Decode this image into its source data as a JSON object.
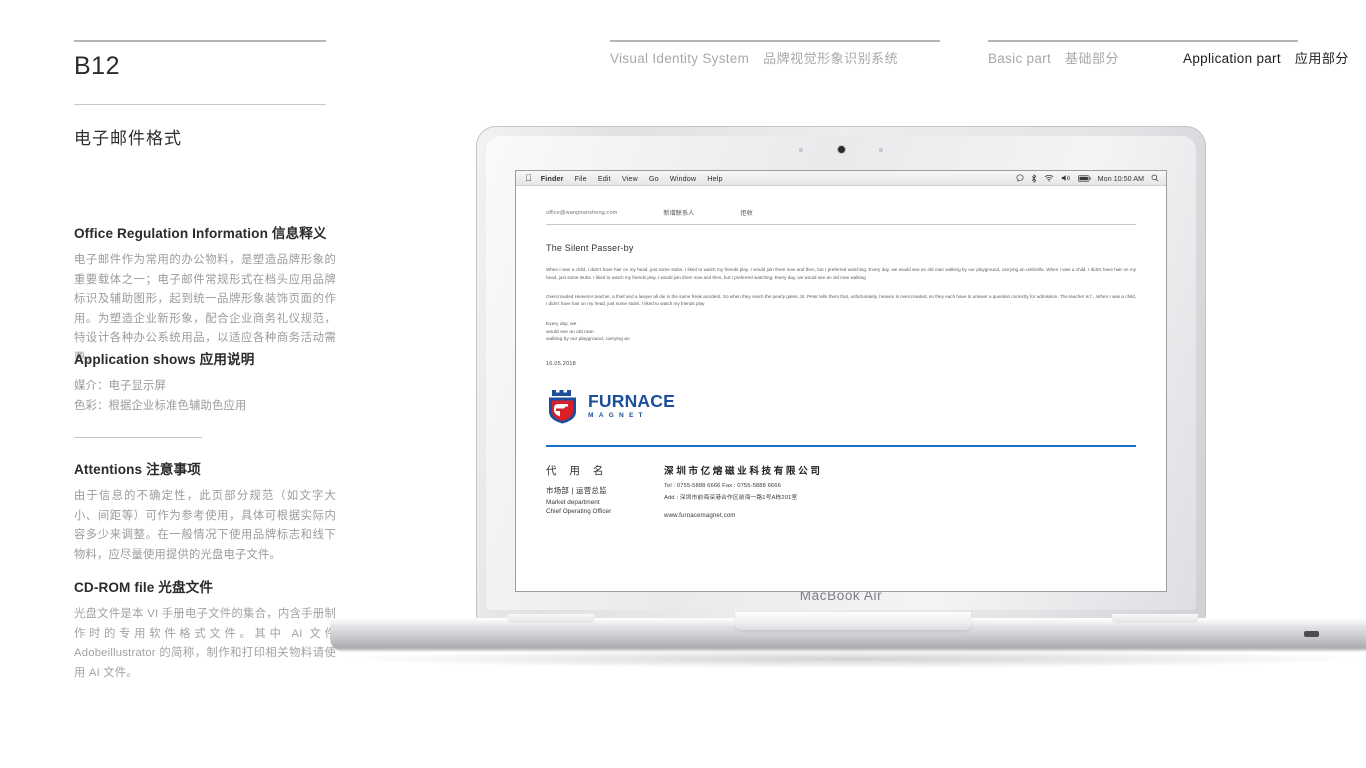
{
  "header": {
    "page_code": "B12",
    "sheet_title": "电子邮件格式",
    "nav": {
      "vis_en": "Visual Identity System",
      "vis_cn": "品牌视觉形象识别系统",
      "basic_en": "Basic part",
      "basic_cn": "基础部分",
      "application_en": "Application part",
      "application_cn": "应用部分"
    }
  },
  "sidebar": {
    "office": {
      "heading": "Office Regulation Information 信息释义",
      "body": "电子邮件作为常用的办公物料，是塑造品牌形象的重要载体之一；电子邮件常规形式在档头应用品牌标识及辅助图形，起到统一品牌形象装饰页面的作用。为塑造企业新形象，配合企业商务礼仪规范，特设计各种办公系统用品，以适应各种商务活动需要。"
    },
    "appshow": {
      "heading": "Application shows 应用说明",
      "line1": "媒介：电子显示屏",
      "line2": "色彩：根据企业标准色辅助色应用"
    },
    "attentions": {
      "heading": "Attentions 注意事项",
      "body": "由于信息的不确定性，此页部分规范（如文字大小、间距等）可作为参考使用，具体可根据实际内容多少来调整。在一般情况下使用品牌标志和线下物料，应尽量使用提供的光盘电子文件。"
    },
    "cdrom": {
      "heading": "CD-ROM file 光盘文件",
      "body": "光盘文件是本 VI 手册电子文件的集合，内含手册制作时的专用软件格式文件。其中 AI 文件 Adobeillustrator 的简称，制作和打印相关物料请使用 AI 文件。"
    }
  },
  "device": {
    "brand": "MacBook Air"
  },
  "menubar": {
    "apple": "",
    "items": [
      "Finder",
      "File",
      "Edit",
      "View",
      "Go",
      "Window",
      "Help"
    ],
    "clock": "Mon 10:50 AM",
    "status_icons": [
      "notification-icon",
      "bluetooth-icon",
      "wifi-icon",
      "volume-icon",
      "battery-icon",
      "spotlight-search-icon"
    ]
  },
  "mail": {
    "from": "office@wanpiransheng.com",
    "action_new_contact": "新增联系人",
    "action_reject": "拒收",
    "subject": "The Silent Passer-by",
    "paragraph1": "When I was a child, I didn't have hair on my head, just some stubs. I liked to watch my friends play. I would join them now and then, but I preferred watching. Every day, we would see an old man walking by our playground, carrying an umbrella. When I was a child, I didn't have hair on my head, just some stubs. I liked to watch my friends play. I would join them now and then, but I preferred watching. Every day, we would see an old man walking",
    "paragraph2": "Overcrowded HeavenA teacher, a thief and a lawyer all die in the same freak accident. So when they reach the pearly gates, St. Peter tells them that, unfortunately, heaven is overcrowded, so they each have to answer a question correctly for admission. The teacher is f…When I was a child, I didn't have hair on my head, just some stubs. I liked to watch my friends play",
    "lines": [
      "Every day, we",
      "would see an old man",
      "walking by our playground, carrying an"
    ],
    "date": "16.05.2018"
  },
  "logo": {
    "word": "FURNACE",
    "sub": "MAGNET",
    "mark": "furnace-magnet-shield-icon",
    "blue": "#1b4f9c",
    "red": "#d6202a"
  },
  "signature": {
    "name_cn": "代 用 名",
    "role_cn": "市场部 | 运营总监",
    "role_en_1": "Market department",
    "role_en_2": "Chief Operating Officer",
    "company_cn": "深圳市亿熔磁业科技有限公司",
    "tel": "Tel : 0755-5888 6666    Fax : 0755-5888 6666",
    "address": "Add : 深圳市前海深港合作区前海一路1号A栋201室",
    "website": "www.furnacemagnet.com"
  },
  "colors": {
    "rule": "#b5b5b5",
    "accent_blue": "#1a6fc4",
    "muted_text": "#a8a8a8"
  }
}
